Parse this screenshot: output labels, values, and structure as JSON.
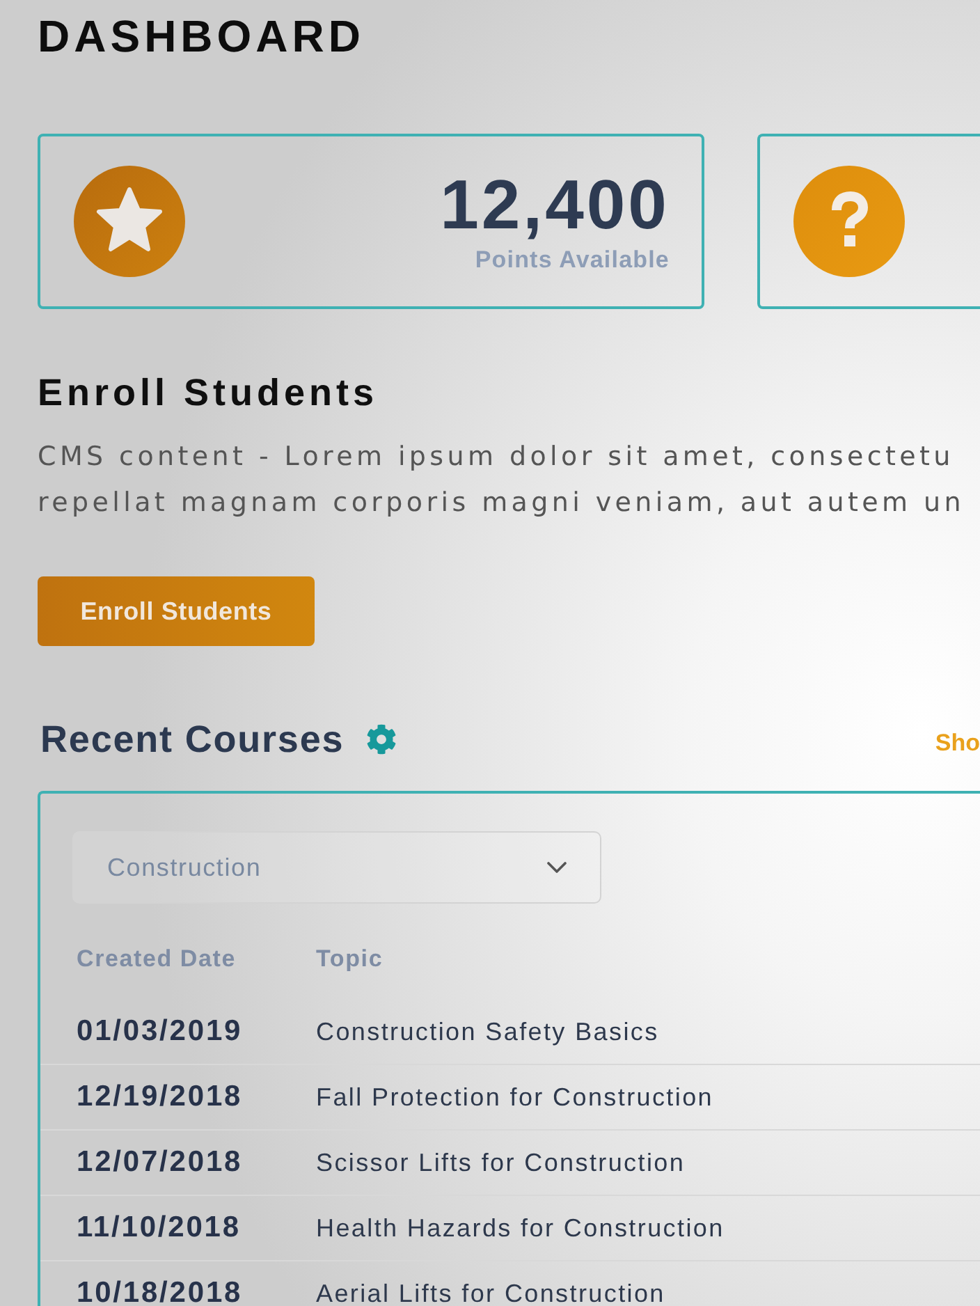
{
  "page": {
    "title": "DASHBOARD"
  },
  "stat_cards": [
    {
      "kind": "points",
      "value": "12,400",
      "label": "Points Available"
    },
    {
      "kind": "help"
    }
  ],
  "enroll": {
    "heading": "Enroll Students",
    "description_lines": [
      "CMS content - Lorem ipsum dolor sit amet, consectetu",
      "repellat magnam corporis magni veniam, aut autem un"
    ],
    "button": "Enroll Students"
  },
  "recent_courses": {
    "title": "Recent Courses",
    "link": "Sho",
    "filter": {
      "value": "Construction"
    },
    "table": {
      "columns": [
        "Created Date",
        "Topic"
      ],
      "rows": [
        [
          "01/03/2019",
          "Construction Safety Basics"
        ],
        [
          "12/19/2018",
          "Fall Protection for Construction"
        ],
        [
          "12/07/2018",
          "Scissor Lifts for Construction"
        ],
        [
          "11/10/2018",
          "Health Hazards for Construction"
        ],
        [
          "10/18/2018",
          "Aerial Lifts for Construction"
        ]
      ]
    }
  }
}
